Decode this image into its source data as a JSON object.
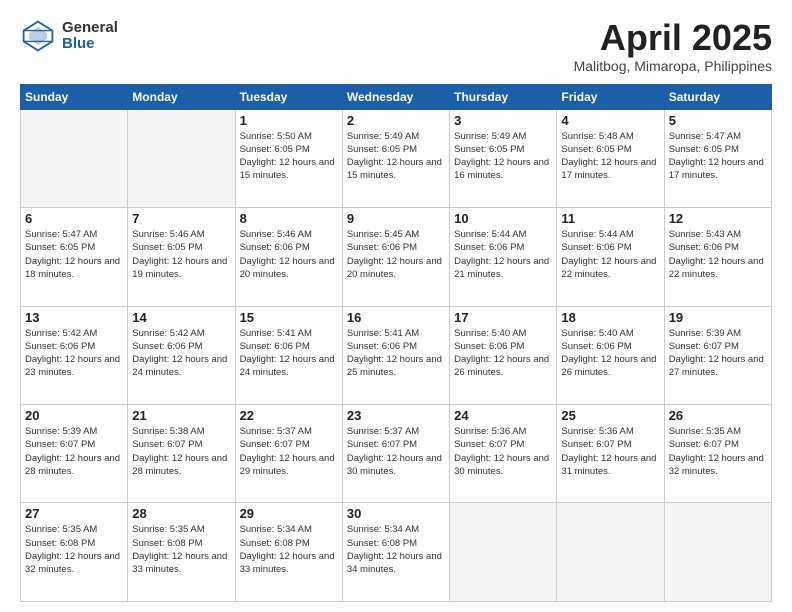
{
  "header": {
    "logo_general": "General",
    "logo_blue": "Blue",
    "month_title": "April 2025",
    "location": "Malitbog, Mimaropa, Philippines"
  },
  "days_of_week": [
    "Sunday",
    "Monday",
    "Tuesday",
    "Wednesday",
    "Thursday",
    "Friday",
    "Saturday"
  ],
  "weeks": [
    [
      {
        "day": "",
        "info": ""
      },
      {
        "day": "",
        "info": ""
      },
      {
        "day": "1",
        "info": "Sunrise: 5:50 AM\nSunset: 6:05 PM\nDaylight: 12 hours and 15 minutes."
      },
      {
        "day": "2",
        "info": "Sunrise: 5:49 AM\nSunset: 6:05 PM\nDaylight: 12 hours and 15 minutes."
      },
      {
        "day": "3",
        "info": "Sunrise: 5:49 AM\nSunset: 6:05 PM\nDaylight: 12 hours and 16 minutes."
      },
      {
        "day": "4",
        "info": "Sunrise: 5:48 AM\nSunset: 6:05 PM\nDaylight: 12 hours and 17 minutes."
      },
      {
        "day": "5",
        "info": "Sunrise: 5:47 AM\nSunset: 6:05 PM\nDaylight: 12 hours and 17 minutes."
      }
    ],
    [
      {
        "day": "6",
        "info": "Sunrise: 5:47 AM\nSunset: 6:05 PM\nDaylight: 12 hours and 18 minutes."
      },
      {
        "day": "7",
        "info": "Sunrise: 5:46 AM\nSunset: 6:05 PM\nDaylight: 12 hours and 19 minutes."
      },
      {
        "day": "8",
        "info": "Sunrise: 5:46 AM\nSunset: 6:06 PM\nDaylight: 12 hours and 20 minutes."
      },
      {
        "day": "9",
        "info": "Sunrise: 5:45 AM\nSunset: 6:06 PM\nDaylight: 12 hours and 20 minutes."
      },
      {
        "day": "10",
        "info": "Sunrise: 5:44 AM\nSunset: 6:06 PM\nDaylight: 12 hours and 21 minutes."
      },
      {
        "day": "11",
        "info": "Sunrise: 5:44 AM\nSunset: 6:06 PM\nDaylight: 12 hours and 22 minutes."
      },
      {
        "day": "12",
        "info": "Sunrise: 5:43 AM\nSunset: 6:06 PM\nDaylight: 12 hours and 22 minutes."
      }
    ],
    [
      {
        "day": "13",
        "info": "Sunrise: 5:42 AM\nSunset: 6:06 PM\nDaylight: 12 hours and 23 minutes."
      },
      {
        "day": "14",
        "info": "Sunrise: 5:42 AM\nSunset: 6:06 PM\nDaylight: 12 hours and 24 minutes."
      },
      {
        "day": "15",
        "info": "Sunrise: 5:41 AM\nSunset: 6:06 PM\nDaylight: 12 hours and 24 minutes."
      },
      {
        "day": "16",
        "info": "Sunrise: 5:41 AM\nSunset: 6:06 PM\nDaylight: 12 hours and 25 minutes."
      },
      {
        "day": "17",
        "info": "Sunrise: 5:40 AM\nSunset: 6:06 PM\nDaylight: 12 hours and 26 minutes."
      },
      {
        "day": "18",
        "info": "Sunrise: 5:40 AM\nSunset: 6:06 PM\nDaylight: 12 hours and 26 minutes."
      },
      {
        "day": "19",
        "info": "Sunrise: 5:39 AM\nSunset: 6:07 PM\nDaylight: 12 hours and 27 minutes."
      }
    ],
    [
      {
        "day": "20",
        "info": "Sunrise: 5:39 AM\nSunset: 6:07 PM\nDaylight: 12 hours and 28 minutes."
      },
      {
        "day": "21",
        "info": "Sunrise: 5:38 AM\nSunset: 6:07 PM\nDaylight: 12 hours and 28 minutes."
      },
      {
        "day": "22",
        "info": "Sunrise: 5:37 AM\nSunset: 6:07 PM\nDaylight: 12 hours and 29 minutes."
      },
      {
        "day": "23",
        "info": "Sunrise: 5:37 AM\nSunset: 6:07 PM\nDaylight: 12 hours and 30 minutes."
      },
      {
        "day": "24",
        "info": "Sunrise: 5:36 AM\nSunset: 6:07 PM\nDaylight: 12 hours and 30 minutes."
      },
      {
        "day": "25",
        "info": "Sunrise: 5:36 AM\nSunset: 6:07 PM\nDaylight: 12 hours and 31 minutes."
      },
      {
        "day": "26",
        "info": "Sunrise: 5:35 AM\nSunset: 6:07 PM\nDaylight: 12 hours and 32 minutes."
      }
    ],
    [
      {
        "day": "27",
        "info": "Sunrise: 5:35 AM\nSunset: 6:08 PM\nDaylight: 12 hours and 32 minutes."
      },
      {
        "day": "28",
        "info": "Sunrise: 5:35 AM\nSunset: 6:08 PM\nDaylight: 12 hours and 33 minutes."
      },
      {
        "day": "29",
        "info": "Sunrise: 5:34 AM\nSunset: 6:08 PM\nDaylight: 12 hours and 33 minutes."
      },
      {
        "day": "30",
        "info": "Sunrise: 5:34 AM\nSunset: 6:08 PM\nDaylight: 12 hours and 34 minutes."
      },
      {
        "day": "",
        "info": ""
      },
      {
        "day": "",
        "info": ""
      },
      {
        "day": "",
        "info": ""
      }
    ]
  ]
}
